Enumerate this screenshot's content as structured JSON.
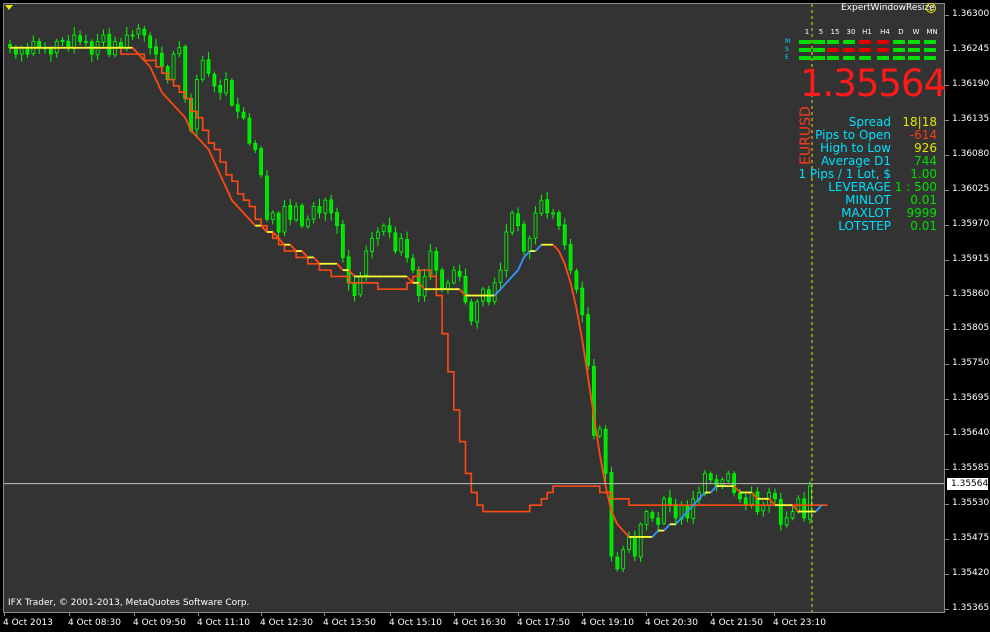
{
  "panel": {
    "resize_label": "ExpertWindowResize",
    "timeframes": [
      "1",
      "5",
      "15",
      "30",
      "H1",
      "H4",
      "D",
      "W",
      "MN"
    ],
    "row_labels": [
      "M",
      "S",
      "E"
    ],
    "trend_colors": {
      "M": [
        "#00e000",
        "#00e000",
        "#00e000",
        "#00e000",
        "#e00000",
        "#e00000",
        "#00e000",
        "#00e000",
        "#00e000"
      ],
      "S": [
        "#00e000",
        "#00e000",
        "#e00000",
        "#e00000",
        "#e00000",
        "#e00000",
        "#00e000",
        "#00e000",
        "#00e000"
      ],
      "E": [
        "#00e000",
        "#00e000",
        "#00e000",
        "#00e000",
        "#00e000",
        "#00e000",
        "#00e000",
        "#00e000",
        "#00e000"
      ]
    },
    "price": "1.35564",
    "symbol": "EURUSD",
    "info": [
      {
        "label": "Spread",
        "value": "18|18",
        "color": "#e6e600"
      },
      {
        "label": "Pips to Open",
        "value": "-614",
        "color": "#ff3a1a"
      },
      {
        "label": "High to Low",
        "value": "926",
        "color": "#e6e600"
      },
      {
        "label": "Average D1",
        "value": "744",
        "color": "#00e000"
      },
      {
        "label": "1 Pips / 1 Lot, $",
        "value": "1.00",
        "color": "#00e000"
      },
      {
        "label": "LEVERAGE",
        "value": "1 : 500",
        "color": "#00e000"
      },
      {
        "label": "MINLOT",
        "value": "0.01",
        "color": "#00e000"
      },
      {
        "label": "MAXLOT",
        "value": "9999",
        "color": "#00e000"
      },
      {
        "label": "LOTSTEP",
        "value": "0.01",
        "color": "#00e000"
      }
    ]
  },
  "copyright": "IFX Trader, © 2001-2013, MetaQuotes Software Corp.",
  "current_price_tag": "1.35564",
  "colors": {
    "bull": "#00ff00",
    "bear": "#00e000",
    "ma_slow": "#ff4a12",
    "ma_fast_up": "#3399ff",
    "ma_fast_flat": "#ffff33",
    "bid_line": "#c0c0c0",
    "period_sep": "#e6e600"
  },
  "chart_data": {
    "type": "candlestick",
    "symbol": "EURUSD",
    "y_axis_ticks": [
      "1.36300",
      "1.36245",
      "1.36190",
      "1.36135",
      "1.36080",
      "1.36025",
      "1.35970",
      "1.35915",
      "1.35860",
      "1.35805",
      "1.35750",
      "1.35695",
      "1.35640",
      "1.35585",
      "1.35530",
      "1.35475",
      "1.35420",
      "1.35365"
    ],
    "ylim": [
      1.35355,
      1.3631
    ],
    "x_axis_labels": [
      "4 Oct 2013",
      "4 Oct 08:30",
      "4 Oct 09:50",
      "4 Oct 11:10",
      "4 Oct 12:30",
      "4 Oct 13:50",
      "4 Oct 15:10",
      "4 Oct 16:30",
      "4 Oct 17:50",
      "4 Oct 19:10",
      "4 Oct 20:30",
      "4 Oct 21:50",
      "4 Oct 23:10"
    ],
    "bid": 1.35564,
    "close_series": [
      1.3625,
      1.3624,
      1.3625,
      1.3624,
      1.3626,
      1.3625,
      1.3625,
      1.3624,
      1.3626,
      1.3626,
      1.3625,
      1.3627,
      1.3626,
      1.3626,
      1.3624,
      1.3626,
      1.3627,
      1.3624,
      1.3626,
      1.3625,
      1.3627,
      1.3627,
      1.3628,
      1.3627,
      1.3625,
      1.3624,
      1.3622,
      1.362,
      1.3624,
      1.3625,
      1.3617,
      1.3612,
      1.362,
      1.3623,
      1.3621,
      1.3619,
      1.3618,
      1.362,
      1.3616,
      1.3615,
      1.3614,
      1.361,
      1.3609,
      1.3605,
      1.3598,
      1.3599,
      1.3596,
      1.36,
      1.3598,
      1.36,
      1.3597,
      1.3598,
      1.36,
      1.3599,
      1.3601,
      1.3599,
      1.3597,
      1.3592,
      1.3588,
      1.3586,
      1.3589,
      1.3593,
      1.3595,
      1.3596,
      1.3597,
      1.3596,
      1.3593,
      1.3595,
      1.3592,
      1.359,
      1.3586,
      1.3589,
      1.3593,
      1.359,
      1.3587,
      1.3588,
      1.359,
      1.3589,
      1.3585,
      1.3582,
      1.3585,
      1.3587,
      1.3585,
      1.3588,
      1.359,
      1.3596,
      1.3599,
      1.3597,
      1.3593,
      1.3595,
      1.3599,
      1.3601,
      1.3599,
      1.3599,
      1.3597,
      1.3594,
      1.359,
      1.3587,
      1.3583,
      1.3575,
      1.3564,
      1.3565,
      1.3558,
      1.3545,
      1.3543,
      1.3546,
      1.3548,
      1.3545,
      1.355,
      1.3552,
      1.3551,
      1.355,
      1.3554,
      1.3553,
      1.3551,
      1.3553,
      1.3551,
      1.3554,
      1.3555,
      1.3558,
      1.3557,
      1.3556,
      1.3557,
      1.3558,
      1.3555,
      1.3554,
      1.3553,
      1.3555,
      1.3552,
      1.3553,
      1.3555,
      1.3554,
      1.355,
      1.3551,
      1.3552,
      1.3554,
      1.3551,
      1.3556
    ],
    "ma_slow": [
      1.3625,
      1.3625,
      1.3625,
      1.3625,
      1.3625,
      1.3625,
      1.3625,
      1.3625,
      1.3625,
      1.3625,
      1.3625,
      1.3625,
      1.3625,
      1.3625,
      1.3625,
      1.3625,
      1.3625,
      1.3625,
      1.3625,
      1.3624,
      1.3624,
      1.3624,
      1.3624,
      1.3623,
      1.3623,
      1.3622,
      1.3621,
      1.362,
      1.3619,
      1.3618,
      1.3617,
      1.3615,
      1.3614,
      1.3612,
      1.361,
      1.3609,
      1.3607,
      1.3605,
      1.3604,
      1.3602,
      1.3601,
      1.36,
      1.3598,
      1.3597,
      1.3596,
      1.3595,
      1.3594,
      1.3593,
      1.3593,
      1.3592,
      1.3592,
      1.3591,
      1.3591,
      1.359,
      1.359,
      1.3589,
      1.3589,
      1.3589,
      1.3588,
      1.3588,
      1.3588,
      1.3588,
      1.3588,
      1.3587,
      1.3587,
      1.3587,
      1.3587,
      1.3587,
      1.3588,
      1.3589,
      1.359,
      1.359,
      1.3589,
      1.3586,
      1.358,
      1.3574,
      1.3568,
      1.3563,
      1.3558,
      1.3555,
      1.3553,
      1.3552,
      1.3552,
      1.3552,
      1.3552,
      1.3552,
      1.3552,
      1.3552,
      1.3552,
      1.3553,
      1.3553,
      1.3554,
      1.3555,
      1.3556,
      1.3556,
      1.3556,
      1.3556,
      1.3556,
      1.3556,
      1.3556,
      1.3556,
      1.3555,
      1.3555,
      1.3554,
      1.3554,
      1.3554,
      1.3553,
      1.3553,
      1.3553,
      1.3553,
      1.3553,
      1.3553,
      1.3553,
      1.3553,
      1.3553,
      1.3553,
      1.3553,
      1.3553,
      1.3553,
      1.3553,
      1.3553,
      1.3553,
      1.3553,
      1.3553,
      1.3553,
      1.3553,
      1.3553,
      1.3553,
      1.3553,
      1.3553,
      1.3553,
      1.3553,
      1.3553,
      1.3553,
      1.3553,
      1.3553,
      1.3553,
      1.3553,
      1.3553,
      1.3553,
      1.3553
    ],
    "ma_fast": [
      1.3625,
      1.3625,
      1.3625,
      1.3625,
      1.3625,
      1.3625,
      1.3625,
      1.3625,
      1.3625,
      1.3625,
      1.3625,
      1.3625,
      1.3625,
      1.3625,
      1.3625,
      1.3625,
      1.3625,
      1.3625,
      1.3625,
      1.3625,
      1.3625,
      1.3625,
      1.3624,
      1.3623,
      1.3622,
      1.362,
      1.3618,
      1.3617,
      1.3616,
      1.3615,
      1.3614,
      1.3612,
      1.3611,
      1.361,
      1.3609,
      1.3607,
      1.3605,
      1.3603,
      1.3601,
      1.36,
      1.3599,
      1.3598,
      1.3597,
      1.3597,
      1.3596,
      1.3596,
      1.3595,
      1.3594,
      1.3594,
      1.3593,
      1.3593,
      1.3592,
      1.3592,
      1.3591,
      1.3591,
      1.3591,
      1.3591,
      1.359,
      1.359,
      1.3589,
      1.3589,
      1.3589,
      1.3589,
      1.3589,
      1.3589,
      1.3589,
      1.3589,
      1.3589,
      1.3589,
      1.3588,
      1.3588,
      1.3587,
      1.3587,
      1.3587,
      1.3587,
      1.3587,
      1.3587,
      1.3587,
      1.3586,
      1.3586,
      1.3586,
      1.3586,
      1.3586,
      1.3586,
      1.3587,
      1.3588,
      1.3589,
      1.359,
      1.3592,
      1.3593,
      1.3593,
      1.3594,
      1.3594,
      1.3594,
      1.3593,
      1.3591,
      1.3588,
      1.3584,
      1.3579,
      1.3573,
      1.3567,
      1.3561,
      1.3556,
      1.3552,
      1.355,
      1.3549,
      1.3548,
      1.3548,
      1.3548,
      1.3548,
      1.3548,
      1.3549,
      1.3549,
      1.355,
      1.355,
      1.3551,
      1.3552,
      1.3553,
      1.3554,
      1.3555,
      1.3555,
      1.3556,
      1.3556,
      1.3556,
      1.3556,
      1.3555,
      1.3555,
      1.3555,
      1.3554,
      1.3554,
      1.3554,
      1.3553,
      1.3553,
      1.3553,
      1.3553,
      1.3552,
      1.3552,
      1.3552,
      1.3552,
      1.3553
    ]
  }
}
